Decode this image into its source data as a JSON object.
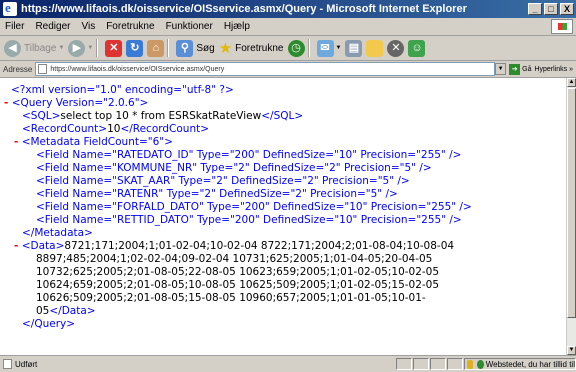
{
  "window": {
    "title": "https://www.lifaois.dk/oisservice/OISservice.asmx/Query - Microsoft Internet Explorer",
    "minimize": "_",
    "maximize": "□",
    "close": "X"
  },
  "menu": [
    "Filer",
    "Rediger",
    "Vis",
    "Foretrukne",
    "Funktioner",
    "Hjælp"
  ],
  "toolbar": {
    "back_label": "Tilbage",
    "search_label": "Søg",
    "favorites_label": "Foretrukne"
  },
  "address": {
    "label": "Adresse",
    "url": "https://www.lifaois.dk/oisservice/OISservice.asmx/Query",
    "go_label": "Gå",
    "links_label": "Hyperlinks"
  },
  "xml": {
    "declaration": "<?xml version=\"1.0\" encoding=\"utf-8\" ?>",
    "query_open": "<Query Version=\"2.0.6\">",
    "sql_open": "<SQL>",
    "sql_value": "select top 10 * from ESRSkatRateView",
    "sql_close": "</SQL>",
    "recordcount_open": "<RecordCount>",
    "recordcount_value": "10",
    "recordcount_close": "</RecordCount>",
    "metadata_open": "<Metadata FieldCount=\"6\">",
    "fields": [
      "<Field Name=\"RATEDATO_ID\" Type=\"200\" DefinedSize=\"10\" Precision=\"255\" />",
      "<Field Name=\"KOMMUNE_NR\" Type=\"2\" DefinedSize=\"2\" Precision=\"5\" />",
      "<Field Name=\"SKAT_AAR\" Type=\"2\" DefinedSize=\"2\" Precision=\"5\" />",
      "<Field Name=\"RATENR\" Type=\"2\" DefinedSize=\"2\" Precision=\"5\" />",
      "<Field Name=\"FORFALD_DATO\" Type=\"200\" DefinedSize=\"10\" Precision=\"255\" />",
      "<Field Name=\"RETTID_DATO\" Type=\"200\" DefinedSize=\"10\" Precision=\"255\" />"
    ],
    "metadata_close": "</Metadata>",
    "data_open": "<Data>",
    "data_lines": [
      "8721;171;2004;1;01-02-04;10-02-04 8722;171;2004;2;01-08-04;10-08-04",
      "8897;485;2004;1;02-02-04;09-02-04 10731;625;2005;1;01-04-05;20-04-05",
      "10732;625;2005;2;01-08-05;22-08-05 10623;659;2005;1;01-02-05;10-02-05",
      "10624;659;2005;2;01-08-05;10-08-05 10625;509;2005;1;01-02-05;15-02-05",
      "10626;509;2005;2;01-08-05;15-08-05 10960;657;2005;1;01-01-05;10-01-",
      "05"
    ],
    "data_close": "</Data>",
    "query_close": "</Query>"
  },
  "status": {
    "text": "Udført",
    "zone": "Webstedet, du har tillid til"
  }
}
